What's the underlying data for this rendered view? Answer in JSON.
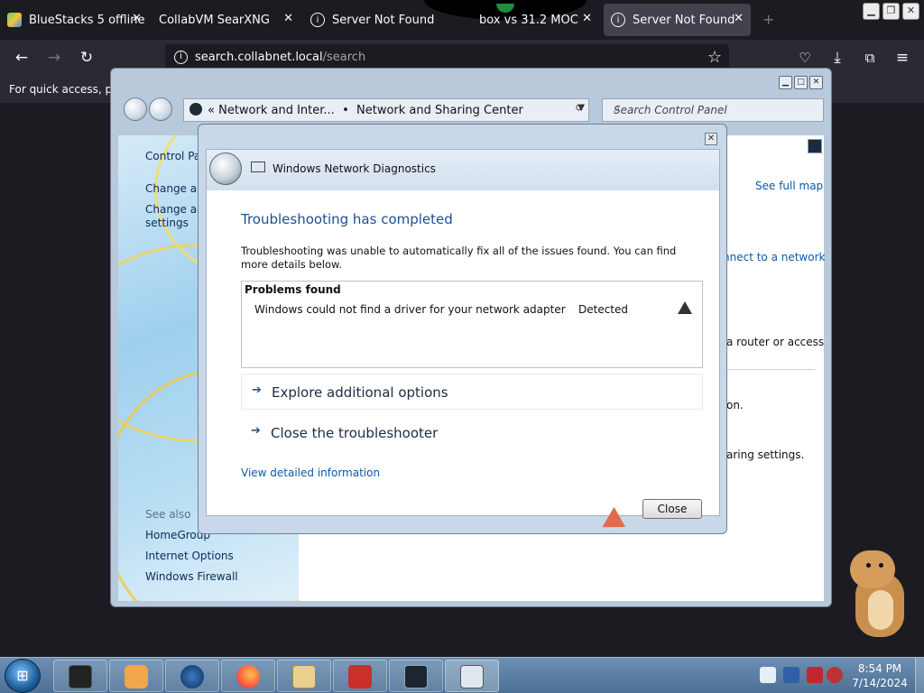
{
  "browser": {
    "tabs": [
      {
        "label": "BlueStacks 5 offline",
        "active": false
      },
      {
        "label": "CollabVM SearXNG",
        "active": false
      },
      {
        "label": "Server Not Found",
        "active": false
      },
      {
        "label": "box vs 31.2 MOC",
        "active": false
      },
      {
        "label": "Server Not Found",
        "active": true
      }
    ],
    "url_host": "search.collabnet.local",
    "url_path": "/search",
    "bookmarks_hint": "For quick access, plac"
  },
  "control_panel": {
    "breadcrumb_1": "Network and Inter...",
    "breadcrumb_2": "Network and Sharing Center",
    "search_placeholder": "Search Control Panel",
    "sidebar": {
      "home": "Control Par",
      "change_adapter": "Change ada",
      "change_advanced_1": "Change adv",
      "change_advanced_2": "settings",
      "see_also": "See also",
      "homegroup": "HomeGroup",
      "internet_options": "Internet Options",
      "windows_firewall": "Windows Firewall"
    },
    "main": {
      "see_full_map": "See full map",
      "connect_network": "nnect to a network",
      "router_text": "a router or access",
      "on_text": "on.",
      "sharing_text": "aring settings."
    }
  },
  "dialog": {
    "title": "Windows Network Diagnostics",
    "heading": "Troubleshooting has completed",
    "message": "Troubleshooting was unable to automatically fix all of the issues found. You can find more details below.",
    "problems_header": "Problems found",
    "problem": {
      "text": "Windows could not find a driver for your network adapter",
      "status": "Detected"
    },
    "option_explore": "Explore additional options",
    "option_close": "Close the troubleshooter",
    "detail_link": "View detailed information",
    "close_button": "Close"
  },
  "taskbar": {
    "time": "8:54 PM",
    "date": "7/14/2024"
  }
}
